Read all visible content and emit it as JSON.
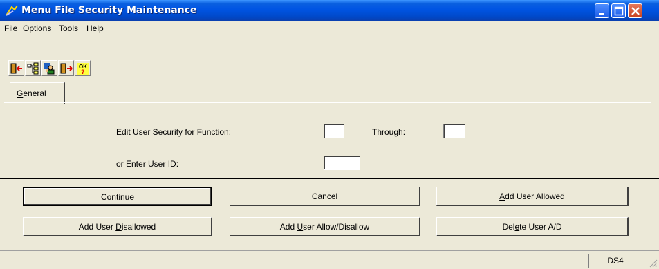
{
  "window": {
    "title": "Menu File Security Maintenance"
  },
  "menu": [
    "File",
    "Options",
    "Tools",
    "Help"
  ],
  "toolbar": [
    "exit-icon",
    "tree-icon",
    "user-group-icon",
    "door-icon",
    "ok-help-icon"
  ],
  "tabs": [
    {
      "label": "General"
    }
  ],
  "form": {
    "function_label": "Edit User Security for Function:",
    "function_value": "",
    "through_label": "Through:",
    "through_value": "",
    "userid_label": "or Enter User ID:",
    "userid_value": ""
  },
  "buttons": {
    "continue": "Continue",
    "cancel": "Cancel",
    "add_allowed": {
      "pre": "",
      "u": "A",
      "post": "dd User Allowed"
    },
    "add_disallowed": {
      "pre": "Add User ",
      "u": "D",
      "post": "isallowed"
    },
    "add_allow_disallow": {
      "pre": "Add ",
      "u": "U",
      "post": "ser Allow/Disallow"
    },
    "delete_ad": {
      "pre": "Del",
      "u": "e",
      "post": "te User A/D"
    }
  },
  "status": {
    "panel": "DS4"
  }
}
